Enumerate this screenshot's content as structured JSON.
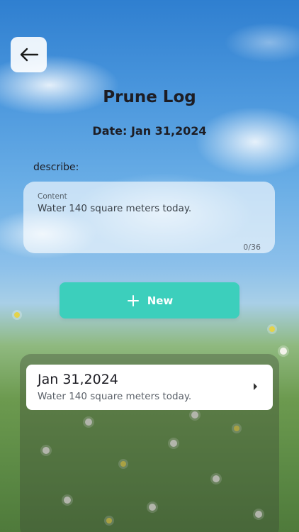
{
  "header": {
    "back_icon": "arrow-left-icon",
    "title": "Prune Log",
    "date_line": "Date: Jan 31,2024"
  },
  "form": {
    "describe_label": "describe:",
    "content_caption": "Content",
    "content_value": "Water 140 square meters today.",
    "char_counter": "0/36"
  },
  "new_button": {
    "icon": "plus-icon",
    "label": "New"
  },
  "records": [
    {
      "date": "Jan 31,2024",
      "description": "Water 140 square meters today.",
      "icon": "chevron-right-icon"
    }
  ],
  "colors": {
    "accent": "#3ccfbc",
    "card": "#ffffff",
    "text": "#1d1d24"
  }
}
